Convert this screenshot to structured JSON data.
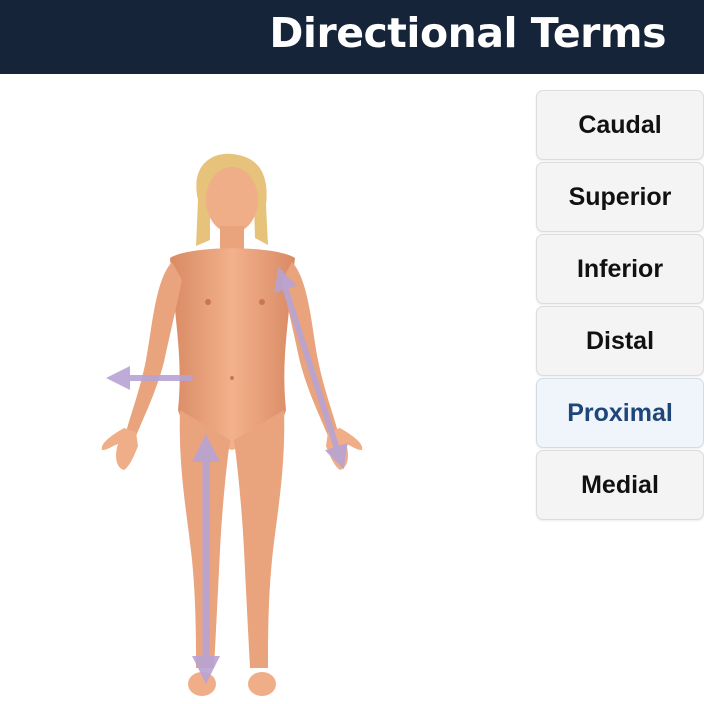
{
  "header": {
    "title": "Directional Terms"
  },
  "figure": {
    "subject": "anatomical-position-female-figure",
    "arrows": [
      "lateral-arrow",
      "arm-arrow",
      "leg-arrow"
    ],
    "skin_color": "#eda47f",
    "arrow_color": "#b8a3d4"
  },
  "terms": {
    "items": [
      {
        "label": "Caudal",
        "selected": false
      },
      {
        "label": "Superior",
        "selected": false
      },
      {
        "label": "Inferior",
        "selected": false
      },
      {
        "label": "Distal",
        "selected": false
      },
      {
        "label": "Proximal",
        "selected": true
      },
      {
        "label": "Medial",
        "selected": false
      }
    ],
    "selected_color": "#1f4678",
    "header_color": "#16243a"
  }
}
